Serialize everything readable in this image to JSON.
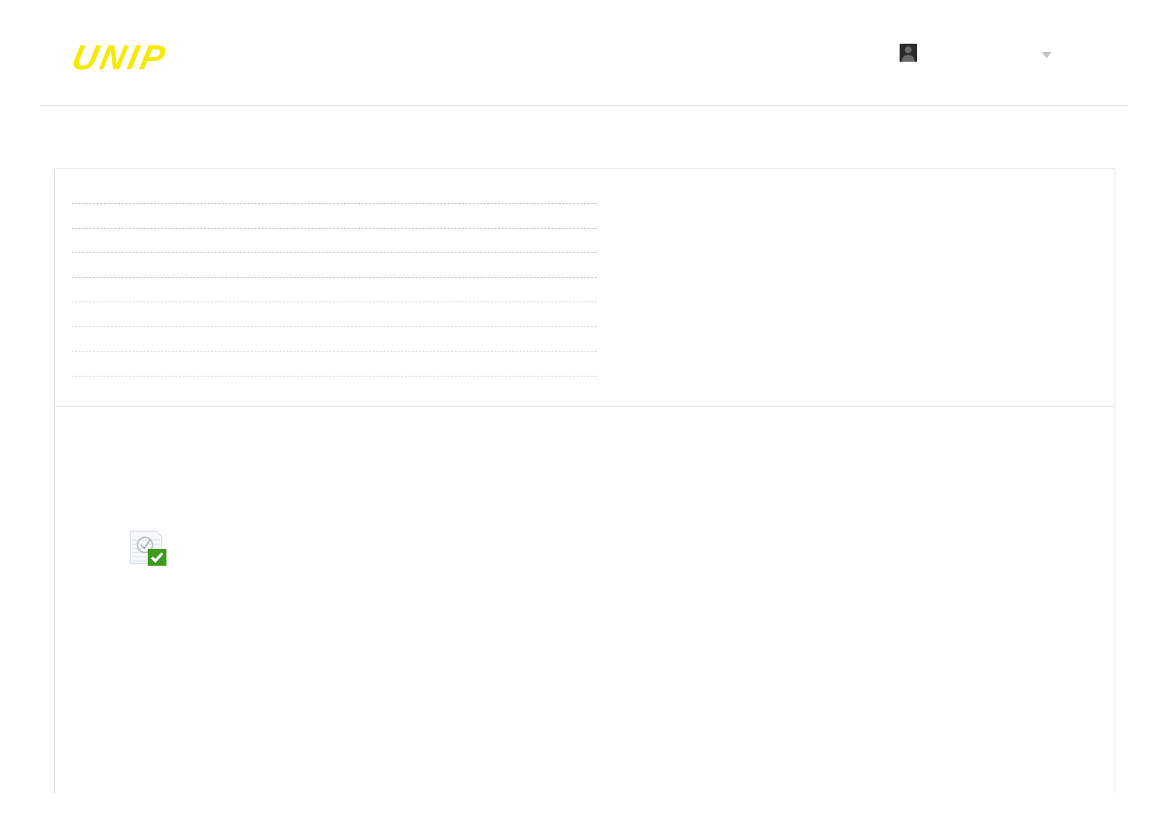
{
  "header": {
    "logo": "UNIP"
  }
}
